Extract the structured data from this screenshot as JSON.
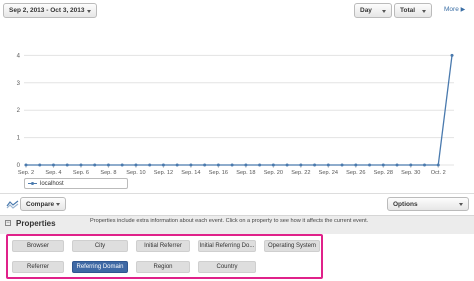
{
  "toolbar": {
    "date_range": "Sep 2, 2013 - Oct 3, 2013",
    "unit": "Day",
    "measure": "Total",
    "more": "More"
  },
  "chart_data": {
    "type": "line",
    "x": [
      "Sep. 2",
      "Sep. 3",
      "Sep. 4",
      "Sep. 5",
      "Sep. 6",
      "Sep. 7",
      "Sep. 8",
      "Sep. 9",
      "Sep. 10",
      "Sep. 11",
      "Sep. 12",
      "Sep. 13",
      "Sep. 14",
      "Sep. 15",
      "Sep. 16",
      "Sep. 17",
      "Sep. 18",
      "Sep. 19",
      "Sep. 20",
      "Sep. 21",
      "Sep. 22",
      "Sep. 23",
      "Sep. 24",
      "Sep. 25",
      "Sep. 26",
      "Sep. 27",
      "Sep. 28",
      "Sep. 29",
      "Sep. 30",
      "Oct. 1",
      "Oct. 2",
      "Oct. 3"
    ],
    "x_tick_labels": [
      "Sep. 2",
      "Sep. 4",
      "Sep. 6",
      "Sep. 8",
      "Sep. 10",
      "Sep. 12",
      "Sep. 14",
      "Sep. 16",
      "Sep. 18",
      "Sep. 20",
      "Sep. 22",
      "Sep. 24",
      "Sep. 26",
      "Sep. 28",
      "Sep. 30",
      "Oct. 2"
    ],
    "series": [
      {
        "name": "localhost",
        "values": [
          0,
          0,
          0,
          0,
          0,
          0,
          0,
          0,
          0,
          0,
          0,
          0,
          0,
          0,
          0,
          0,
          0,
          0,
          0,
          0,
          0,
          0,
          0,
          0,
          0,
          0,
          0,
          0,
          0,
          0,
          0,
          4
        ]
      }
    ],
    "y_ticks": [
      "0",
      "1",
      "2",
      "3",
      "4"
    ],
    "ylim": [
      0,
      5
    ],
    "grid": true,
    "legend_position": "bottom-left",
    "colors": {
      "line": "#4a7aae",
      "grid": "#e3e3e3"
    }
  },
  "compare": {
    "label": "Compare"
  },
  "options": {
    "label": "Options"
  },
  "properties": {
    "title": "Properties",
    "toggle": "⊟",
    "description": "Properties include extra information about each event. Click on a property to see how it affects the current event.",
    "chips": [
      "Browser",
      "City",
      "Initial Referrer",
      "Initial Referring Do...",
      "Operating System",
      "Referrer",
      "Referring Domain",
      "Region",
      "Country"
    ],
    "active_chip": "Referring Domain",
    "highlight_color": "#e0218a"
  }
}
